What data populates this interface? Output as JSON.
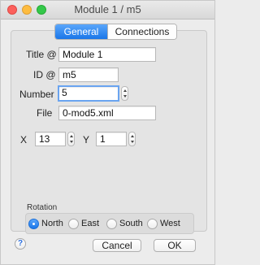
{
  "window": {
    "title": "Module 1 / m5"
  },
  "tabs": [
    {
      "label": "General",
      "active": true
    },
    {
      "label": "Connections",
      "active": false
    }
  ],
  "form": {
    "title_label": "Title @",
    "title_value": "Module 1",
    "id_label": "ID @",
    "id_value": "m5",
    "number_label": "Number",
    "number_value": "5",
    "file_label": "File",
    "file_value": "0-mod5.xml",
    "x_label": "X",
    "x_value": "13",
    "y_label": "Y",
    "y_value": "1"
  },
  "rotation": {
    "label": "Rotation",
    "options": [
      "North",
      "East",
      "South",
      "West"
    ],
    "selected": "North"
  },
  "footer": {
    "help_label": "?",
    "cancel_label": "Cancel",
    "ok_label": "OK"
  },
  "colors": {
    "accent": "#1a76e9"
  }
}
